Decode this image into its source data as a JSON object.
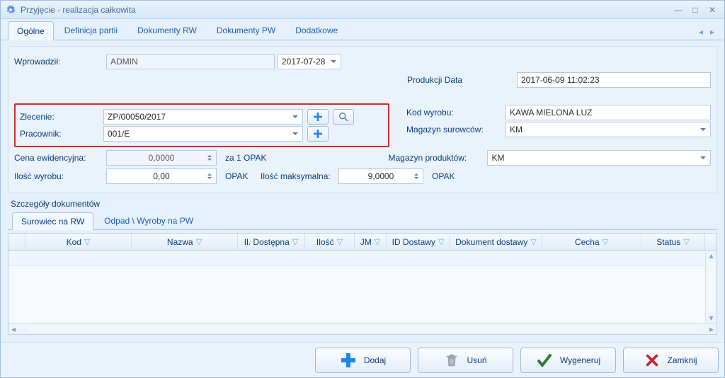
{
  "window": {
    "title": "Przyjęcie - realizacja całkowita"
  },
  "tabs": {
    "items": [
      "Ogólne",
      "Definicja partii",
      "Dokumenty RW",
      "Dokumenty PW",
      "Dodatkowe"
    ],
    "active": 0
  },
  "form": {
    "wprowadzil_label": "Wprowadził:",
    "wprowadzil_value": "ADMIN",
    "wprowadzil_date": "2017-07-28",
    "produkcji_label": "Produkcji Data",
    "produkcji_value": "2017-06-09 11:02:23",
    "zlecenie_label": "Zlecenie:",
    "zlecenie_value": "ZP/00050/2017",
    "pracownik_label": "Pracownik:",
    "pracownik_value": "001/E",
    "kod_wyrobu_label": "Kod wyrobu:",
    "kod_wyrobu_value": "KAWA MIELONA LUZ",
    "mag_surowcow_label": "Magazyn surowców:",
    "mag_surowcow_value": "KM",
    "mag_produktow_label": "Magazyn produktów:",
    "mag_produktow_value": "KM",
    "cena_label": "Cena ewidencyjna:",
    "cena_value": "0,0000",
    "cena_unit": "za 1 OPAK",
    "ilosc_wyrobu_label": "Ilość wyrobu:",
    "ilosc_wyrobu_value": "0,00",
    "ilosc_wyrobu_unit": "OPAK",
    "ilosc_max_label": "Ilość maksymalna:",
    "ilosc_max_value": "9,0000",
    "ilosc_max_unit": "OPAK"
  },
  "details": {
    "section_label": "Szczegóły dokumentów",
    "subtabs": [
      "Surowiec na RW",
      "Odpad \\ Wyroby na PW"
    ],
    "active": 0,
    "columns": [
      "Kod",
      "Nazwa",
      "Il. Dostępna",
      "Ilość",
      "JM",
      "ID Dostawy",
      "Dokument dostawy",
      "Cecha",
      "Status"
    ]
  },
  "buttons": {
    "dodaj": "Dodaj",
    "usun": "Usuń",
    "wygeneruj": "Wygeneruj",
    "zamknij": "Zamknij"
  }
}
